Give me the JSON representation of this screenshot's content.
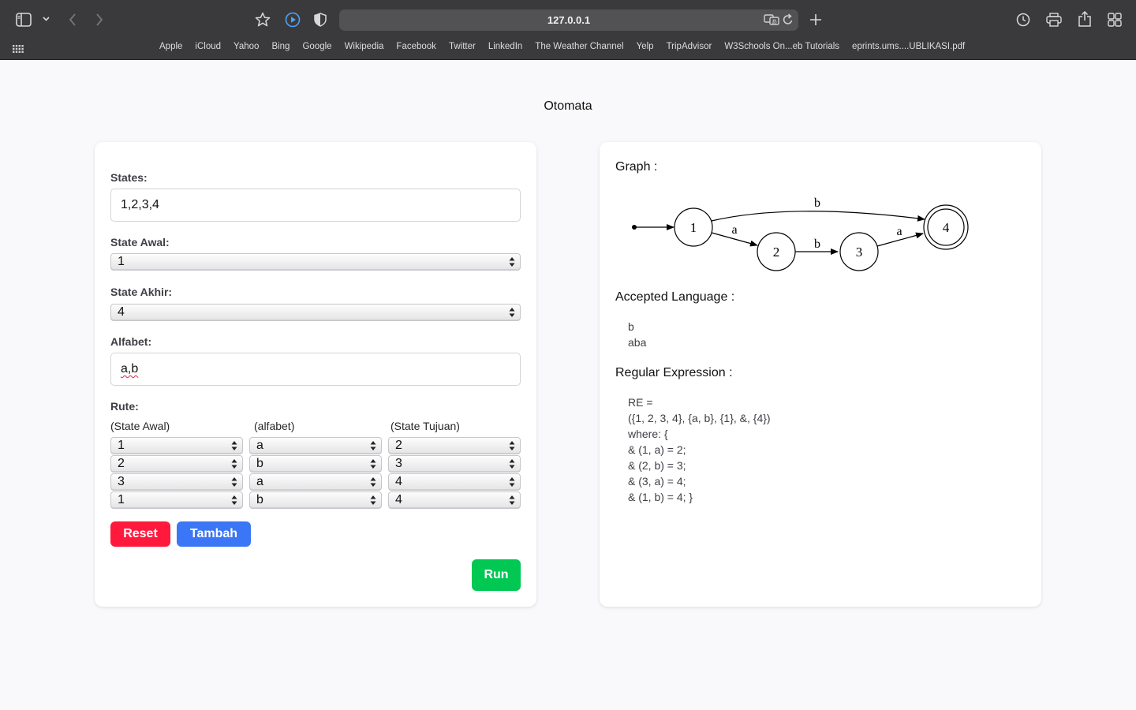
{
  "browser": {
    "url": "127.0.0.1",
    "bookmarks": [
      "Apple",
      "iCloud",
      "Yahoo",
      "Bing",
      "Google",
      "Wikipedia",
      "Facebook",
      "Twitter",
      "LinkedIn",
      "The Weather Channel",
      "Yelp",
      "TripAdvisor",
      "W3Schools On...eb Tutorials",
      "eprints.ums....UBLIKASI.pdf"
    ],
    "icons": [
      "sidebar-icon",
      "chevron-down-icon",
      "back-icon",
      "forward-icon",
      "bookmark-star-icon",
      "play-icon",
      "shield-icon",
      "translate-icon",
      "reload-icon",
      "new-tab-icon",
      "history-icon",
      "print-icon",
      "share-icon",
      "tab-overview-icon",
      "grid-icon"
    ]
  },
  "page": {
    "title": "Otomata"
  },
  "form": {
    "states_label": "States:",
    "states_value": "1,2,3,4",
    "start_label": "State Awal:",
    "start_value": "1",
    "final_label": "State Akhir:",
    "final_value": "4",
    "alphabet_label": "Alfabet:",
    "alphabet_value": "a,b",
    "rules_label": "Rute:",
    "rule_columns": [
      "(State Awal)",
      "(alfabet)",
      "(State Tujuan)"
    ],
    "rules": [
      {
        "from": "1",
        "symbol": "a",
        "to": "2"
      },
      {
        "from": "2",
        "symbol": "b",
        "to": "3"
      },
      {
        "from": "3",
        "symbol": "a",
        "to": "4"
      },
      {
        "from": "1",
        "symbol": "b",
        "to": "4"
      }
    ],
    "reset_label": "Reset",
    "add_label": "Tambah",
    "run_label": "Run"
  },
  "result": {
    "graph_title": "Graph :",
    "graph": {
      "states": [
        "1",
        "2",
        "3",
        "4"
      ],
      "start": "1",
      "accepting": [
        "4"
      ],
      "edges": [
        {
          "from": "1",
          "to": "2",
          "label": "a"
        },
        {
          "from": "2",
          "to": "3",
          "label": "b"
        },
        {
          "from": "3",
          "to": "4",
          "label": "a"
        },
        {
          "from": "1",
          "to": "4",
          "label": "b"
        }
      ]
    },
    "accepted_title": "Accepted Language :",
    "accepted": [
      "b",
      "aba"
    ],
    "regex_title": "Regular Expression :",
    "regex_lines": [
      "RE =",
      "({1, 2, 3, 4}, {a, b}, {1}, &, {4})",
      "where: {",
      "& (1, a) = 2;",
      "& (2, b) = 3;",
      "& (3, a) = 4;",
      "& (1, b) = 4; }"
    ]
  },
  "colors": {
    "reset": "#ff1a3d",
    "add": "#3b76f6",
    "run": "#00c853",
    "chrome": "#3a3a3c"
  }
}
